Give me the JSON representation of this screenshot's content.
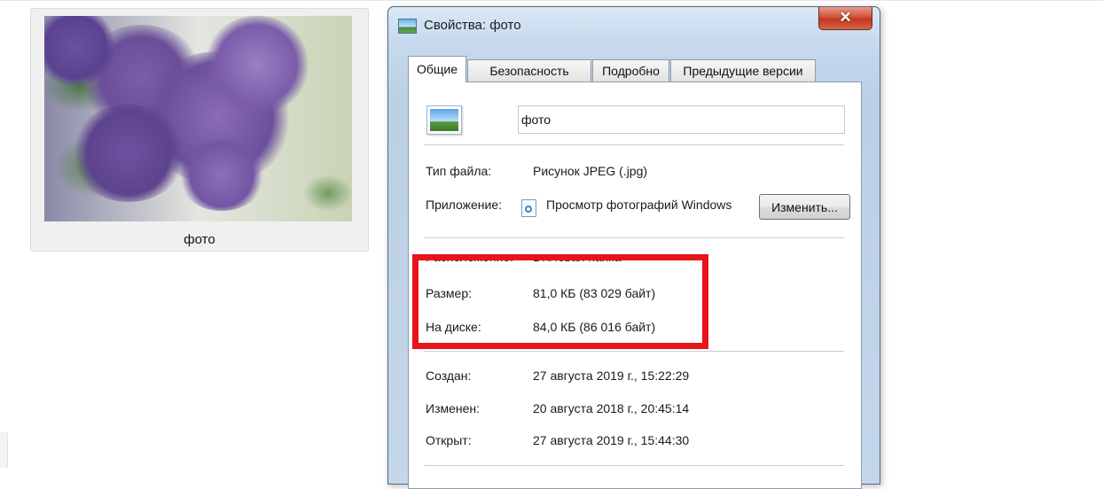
{
  "explorer": {
    "thumbnail_label": "фото"
  },
  "dialog": {
    "title": "Свойства: фото",
    "close_label": "✕",
    "tabs": [
      {
        "label": "Общие",
        "active": true
      },
      {
        "label": "Безопасность",
        "active": false
      },
      {
        "label": "Подробно",
        "active": false
      },
      {
        "label": "Предыдущие версии",
        "active": false
      }
    ],
    "general": {
      "file_name": "фото",
      "file_type_label": "Тип файла:",
      "file_type_value": "Рисунок JPEG (.jpg)",
      "app_label": "Приложение:",
      "app_value": "Просмотр фотографий Windows",
      "change_button": "Изменить...",
      "location_label": "Расположение:",
      "location_value": "D:\\Новая папка",
      "size_label": "Размер:",
      "size_value": "81,0 КБ (83 029 байт)",
      "disk_label": "На диске:",
      "disk_value": "84,0 КБ (86 016 байт)",
      "created_label": "Создан:",
      "created_value": "27 августа 2019 г., 15:22:29",
      "modified_label": "Изменен:",
      "modified_value": "20 августа 2018 г., 20:45:14",
      "opened_label": "Открыт:",
      "opened_value": "27 августа 2019 г., 15:44:30"
    }
  },
  "annotation": {
    "highlight_color": "#e8141c"
  },
  "colors": {
    "close_button": "#c73b22",
    "window_frame": "#bfd3e8"
  }
}
